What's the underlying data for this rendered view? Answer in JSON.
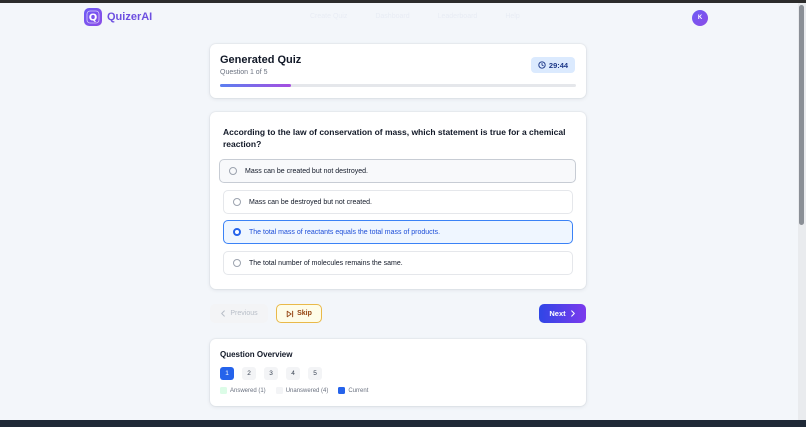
{
  "app": {
    "name": "QuizerAI",
    "logo_letter": "Q",
    "brand_color": "#6d4fe0"
  },
  "nav": {
    "items": [
      "Create Quiz",
      "Dashboard",
      "Leaderboard",
      "Help"
    ]
  },
  "user": {
    "avatar_initial": "K"
  },
  "quiz": {
    "title": "Generated Quiz",
    "subtitle": "Question 1 of 5",
    "timer": "29:44",
    "progress_fraction": 0.2
  },
  "question": {
    "text": "According to the law of conservation of mass, which statement is true for a chemical reaction?",
    "options": [
      {
        "label": "Mass can be created but not destroyed.",
        "state": "hover"
      },
      {
        "label": "Mass can be destroyed but not created.",
        "state": "default"
      },
      {
        "label": "The total mass of reactants equals the total mass of products.",
        "state": "selected"
      },
      {
        "label": "The total number of molecules remains the same.",
        "state": "default"
      }
    ]
  },
  "controls": {
    "previous_label": "Previous",
    "skip_label": "Skip",
    "next_label": "Next"
  },
  "overview": {
    "title": "Question Overview",
    "numbers": [
      "1",
      "2",
      "3",
      "4",
      "5"
    ],
    "current_index": 0,
    "legend": {
      "answered": "Answered (1)",
      "unanswered": "Unanswered (4)",
      "current": "Current"
    },
    "colors": {
      "answered": "#dcfce7",
      "unanswered": "#f3f4f6",
      "current": "#2563eb"
    }
  },
  "icons": {
    "logo": "quiz-logo-icon",
    "timer": "clock-icon",
    "previous": "chevron-left-icon",
    "skip": "skip-forward-icon",
    "next": "chevron-right-icon"
  }
}
